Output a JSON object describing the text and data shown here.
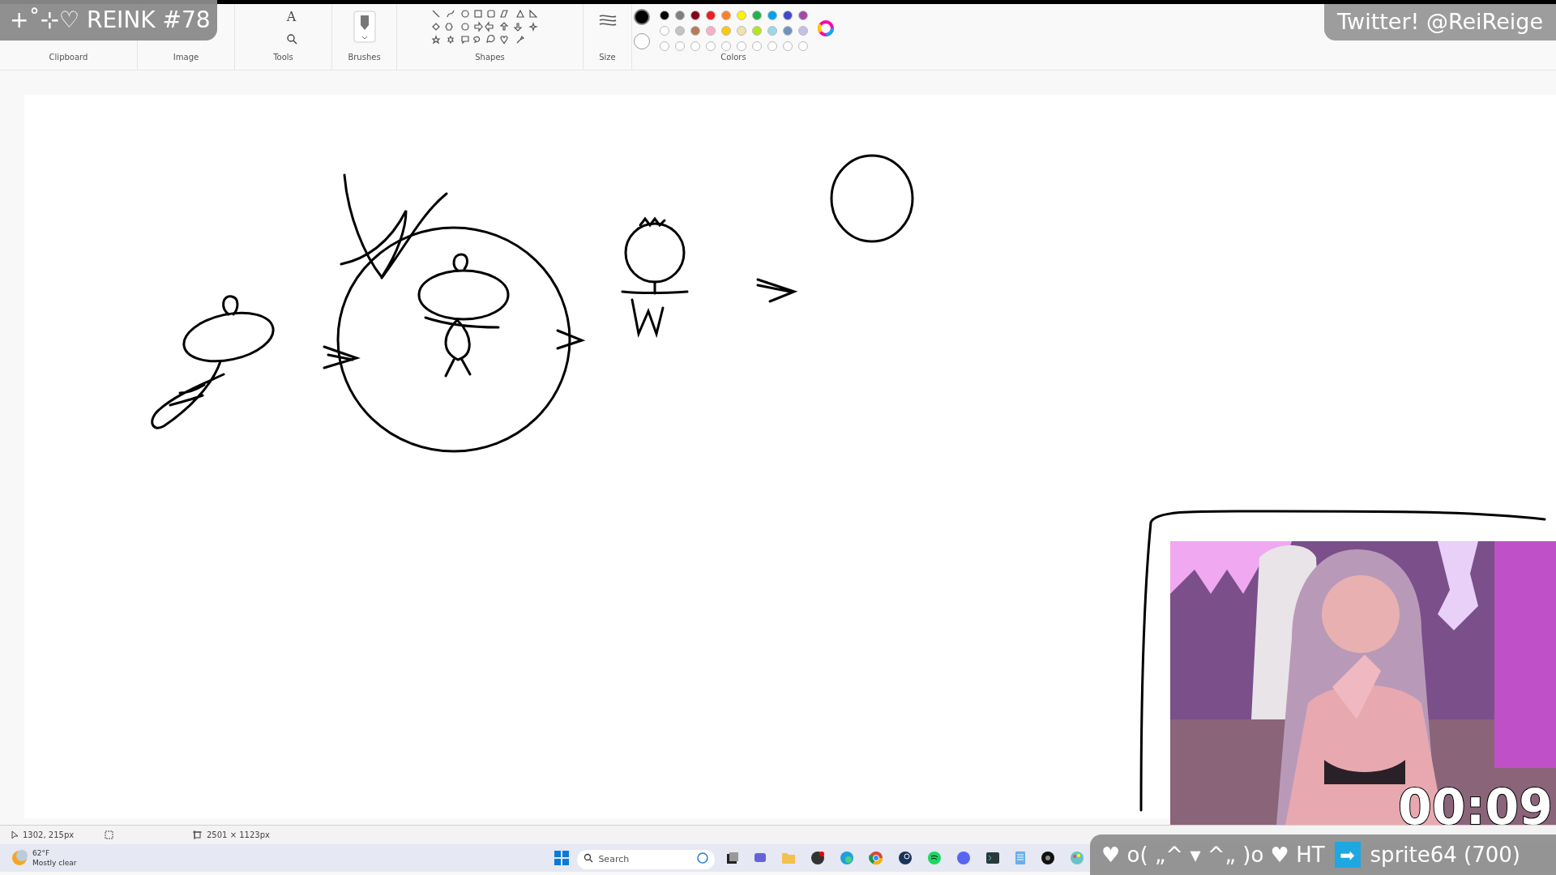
{
  "overlay_title": "+˚⊹♡ REINK #78",
  "overlay_social": "Twitter! @ReiReige",
  "ribbon": {
    "tools_text_tool": "A",
    "groups": [
      "Clipboard",
      "Image",
      "Tools",
      "Brushes",
      "Shapes",
      "Size",
      "Colors"
    ],
    "colors": {
      "current": [
        {
          "color": "#000000"
        },
        {
          "color": "#ffffff"
        }
      ],
      "palette": [
        {
          "color": "#000000"
        },
        {
          "color": "#7f7f7f"
        },
        {
          "color": "#880015"
        },
        {
          "color": "#ed1c24"
        },
        {
          "color": "#ff7f27"
        },
        {
          "color": "#fff200"
        },
        {
          "color": "#22b14c"
        },
        {
          "color": "#00a2e8"
        },
        {
          "color": "#3f48cc"
        },
        {
          "color": "#a349a4"
        },
        {
          "color": "#ffffff"
        },
        {
          "color": "#c3c3c3"
        },
        {
          "color": "#b97a57"
        },
        {
          "color": "#ffaec9"
        },
        {
          "color": "#ffc90e"
        },
        {
          "color": "#efe4b0"
        },
        {
          "color": "#b5e61d"
        },
        {
          "color": "#99d9ea"
        },
        {
          "color": "#7092be"
        },
        {
          "color": "#c8bfe7"
        }
      ]
    }
  },
  "webcam": {
    "kind": "picture",
    "timer": "00:09"
  },
  "status_bar": {
    "cursor_position": "1302, 215px",
    "canvas_size": "2501 × 1123px"
  },
  "taskbar": {
    "weather": {
      "temperature": "62°F",
      "condition": "Mostly clear"
    },
    "search": {
      "placeholder": "Search"
    }
  },
  "alert": {
    "message": "♥ o( „^ ▾ ^„ )o ♥ HT",
    "arrow": "➡",
    "donor": "sprite64 (700)"
  }
}
